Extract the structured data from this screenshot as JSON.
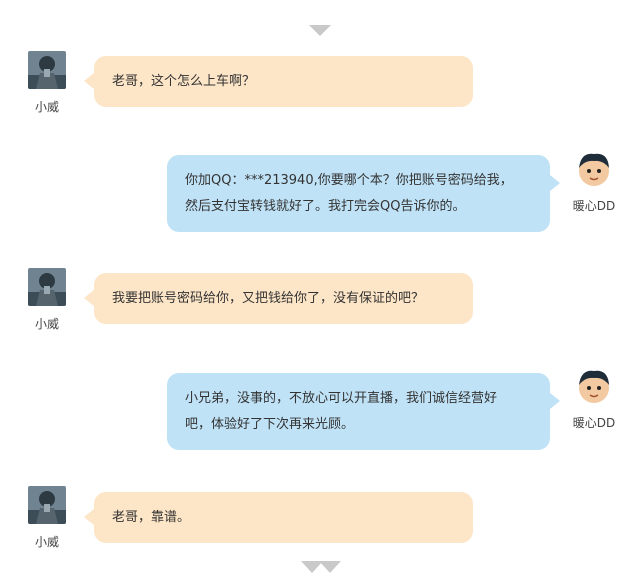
{
  "messages": [
    {
      "side": "left",
      "user": "小威",
      "text": "老哥，这个怎么上车啊？"
    },
    {
      "side": "right",
      "user": "暖心DD",
      "lines": [
        "你加QQ：***213940,你要哪个本？你把账号密码给我，",
        "然后支付宝转钱就好了。我打完会QQ告诉你的。"
      ]
    },
    {
      "side": "left",
      "user": "小威",
      "text": "我要把账号密码给你，又把钱给你了，没有保证的吧？"
    },
    {
      "side": "right",
      "user": "暖心DD",
      "lines": [
        "小兄弟，没事的，不放心可以开直播，我们诚信经营好",
        "吧，体验好了下次再来光顾。"
      ]
    },
    {
      "side": "left",
      "user": "小威",
      "text": "老哥，靠谱。"
    }
  ],
  "icons": {
    "scroll_up": "chevron-down-icon",
    "scroll_down": "double-chevron-down-icon"
  },
  "colors": {
    "left_bubble": "#fde5c7",
    "right_bubble": "#bfe2f6",
    "arrow": "#c9c9c9"
  }
}
